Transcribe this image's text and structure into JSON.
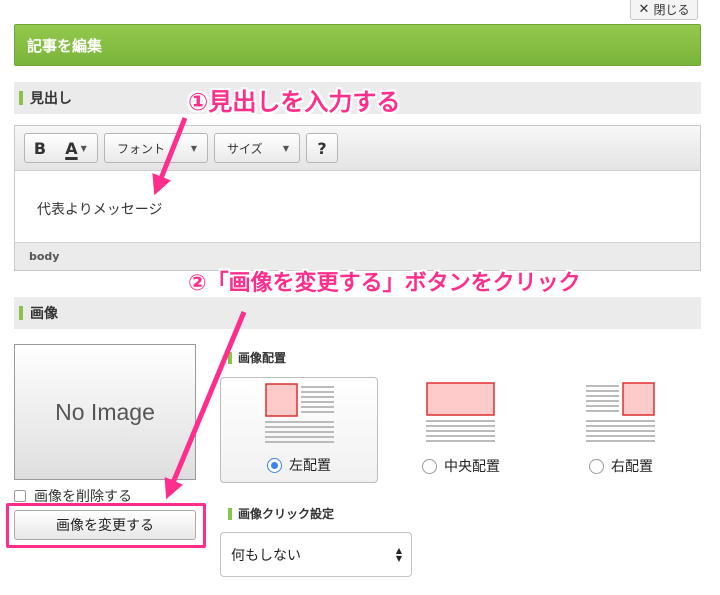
{
  "close_label": "閉じる",
  "title": "記事を編集",
  "heading_section": {
    "title": "見出し"
  },
  "editor": {
    "font_label": "フォント",
    "size_label": "サイズ",
    "bold_label": "B",
    "color_label": "A",
    "help_label": "?",
    "content": "代表よりメッセージ",
    "status_path": "body"
  },
  "image_section": {
    "title": "画像",
    "placeholder": "No Image",
    "delete_label": "画像を削除する",
    "change_label": "画像を変更する",
    "placement": {
      "title": "画像配置",
      "options": [
        {
          "label": "左配置",
          "selected": true
        },
        {
          "label": "中央配置",
          "selected": false
        },
        {
          "label": "右配置",
          "selected": false
        }
      ]
    },
    "click_setting": {
      "title": "画像クリック設定",
      "value": "何もしない"
    }
  },
  "annotations": {
    "step1": "①見出しを入力する",
    "step2": "②「画像を変更する」ボタンをクリック"
  },
  "colors": {
    "accent_green": "#8bc34a",
    "annotation_pink": "#ff2e8c",
    "radio_blue": "#3b84e8",
    "thumb_red": "#e03030"
  }
}
